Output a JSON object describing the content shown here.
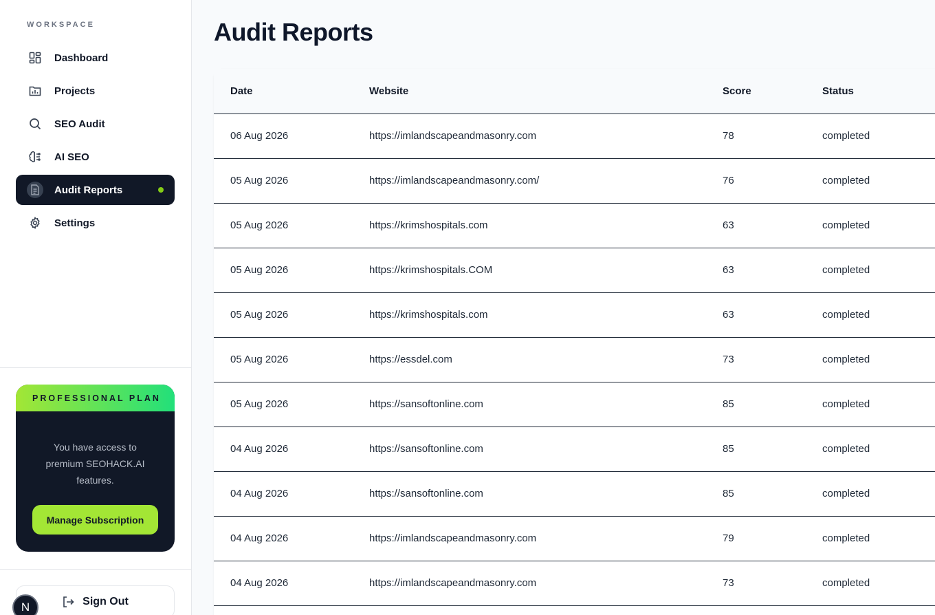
{
  "sidebar": {
    "workspace_label": "WORKSPACE",
    "items": [
      {
        "label": "Dashboard",
        "icon": "dashboard-icon"
      },
      {
        "label": "Projects",
        "icon": "projects-icon"
      },
      {
        "label": "SEO Audit",
        "icon": "search-icon"
      },
      {
        "label": "AI SEO",
        "icon": "brain-icon"
      },
      {
        "label": "Audit Reports",
        "icon": "document-icon",
        "active": true
      },
      {
        "label": "Settings",
        "icon": "gear-icon"
      }
    ],
    "plan": {
      "title": "PROFESSIONAL PLAN",
      "description": "You have access to premium SEOHACK.AI features.",
      "button": "Manage Subscription"
    },
    "sign_out": "Sign Out",
    "avatar_initial": "N"
  },
  "main": {
    "title": "Audit Reports",
    "table": {
      "columns": [
        "Date",
        "Website",
        "Score",
        "Status"
      ],
      "rows": [
        [
          "06 Aug 2026",
          "https://imlandscapeandmasonry.com",
          "78",
          "completed"
        ],
        [
          "05 Aug 2026",
          "https://imlandscapeandmasonry.com/",
          "76",
          "completed"
        ],
        [
          "05 Aug 2026",
          "https://krimshospitals.com",
          "63",
          "completed"
        ],
        [
          "05 Aug 2026",
          "https://krimshospitals.COM",
          "63",
          "completed"
        ],
        [
          "05 Aug 2026",
          "https://krimshospitals.com",
          "63",
          "completed"
        ],
        [
          "05 Aug 2026",
          "https://essdel.com",
          "73",
          "completed"
        ],
        [
          "05 Aug 2026",
          "https://sansoftonline.com",
          "85",
          "completed"
        ],
        [
          "04 Aug 2026",
          "https://sansoftonline.com",
          "85",
          "completed"
        ],
        [
          "04 Aug 2026",
          "https://sansoftonline.com",
          "85",
          "completed"
        ],
        [
          "04 Aug 2026",
          "https://imlandscapeandmasonry.com",
          "79",
          "completed"
        ],
        [
          "04 Aug 2026",
          "https://imlandscapeandmasonry.com",
          "73",
          "completed"
        ]
      ]
    }
  },
  "colors": {
    "accent": "#a3e635",
    "accent_gradient_end": "#22e07a",
    "dark": "#111827",
    "active_dot": "#84cc16"
  }
}
